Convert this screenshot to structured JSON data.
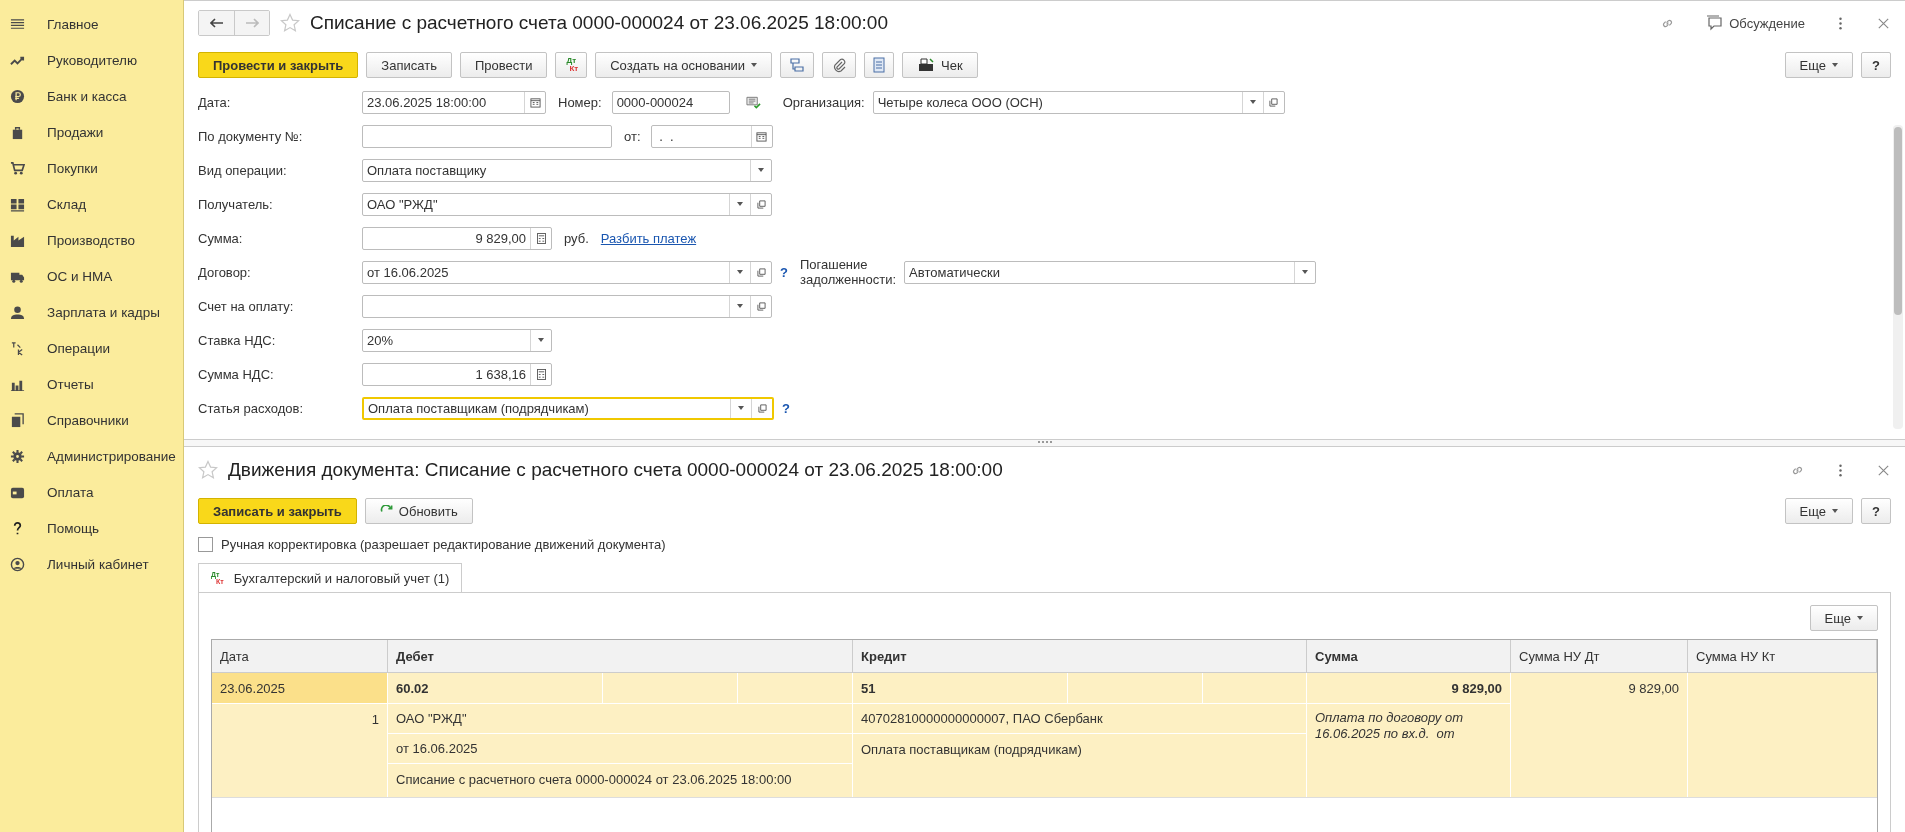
{
  "sidebar": {
    "items": [
      {
        "label": "Главное"
      },
      {
        "label": "Руководителю"
      },
      {
        "label": "Банк и касса"
      },
      {
        "label": "Продажи"
      },
      {
        "label": "Покупки"
      },
      {
        "label": "Склад"
      },
      {
        "label": "Производство"
      },
      {
        "label": "ОС и НМА"
      },
      {
        "label": "Зарплата и кадры"
      },
      {
        "label": "Операции"
      },
      {
        "label": "Отчеты"
      },
      {
        "label": "Справочники"
      },
      {
        "label": "Администрирование"
      },
      {
        "label": "Оплата"
      },
      {
        "label": "Помощь"
      },
      {
        "label": "Личный кабинет"
      }
    ]
  },
  "document": {
    "title": "Списание с расчетного счета 0000-000024 от 23.06.2025 18:00:00",
    "favorite": false,
    "discussion": "Обсуждение",
    "toolbar": {
      "post_close": "Провести и закрыть",
      "save": "Записать",
      "post": "Провести",
      "dt_icon": "Дт",
      "kt_icon": "Кт",
      "create_based": "Создать на основании",
      "check": "Чек",
      "more": "Еще",
      "help": "?"
    },
    "fields": {
      "date": {
        "label": "Дата:",
        "value": "23.06.2025 18:00:00"
      },
      "number": {
        "label": "Номер:",
        "value": "0000-000024"
      },
      "organization": {
        "label": "Организация:",
        "value": "Четыре колеса ООО (ОСН)"
      },
      "doc_number": {
        "label": "По документу №:"
      },
      "doc_date": {
        "label": "от:",
        "value": " .  ."
      },
      "operation": {
        "label": "Вид операции:",
        "value": "Оплата поставщику"
      },
      "recipient": {
        "label": "Получатель:",
        "value": "ОАО \"РЖД\""
      },
      "amount": {
        "label": "Сумма:",
        "value": "9 829,00",
        "currency": "руб.",
        "link": "Разбить платеж"
      },
      "contract": {
        "label": "Договор:",
        "value": "от 16.06.2025",
        "hint": "?"
      },
      "repayment": {
        "label_line1": "Погашение",
        "label_line2": "задолженности:",
        "value": "Автоматически"
      },
      "invoice": {
        "label": "Счет на оплату:"
      },
      "vat_rate": {
        "label": "Ставка НДС:",
        "value": "20%"
      },
      "vat_amount": {
        "label": "Сумма НДС:",
        "value": "1 638,16"
      },
      "expense": {
        "label": "Статья расходов:",
        "value": "Оплата поставщикам (подрядчикам)",
        "focused": true,
        "hint": "?"
      }
    }
  },
  "movements": {
    "title": "Движения документа: Списание с расчетного счета 0000-000024 от 23.06.2025 18:00:00",
    "favorite": false,
    "save_close": "Записать и закрыть",
    "refresh": "Обновить",
    "more": "Еще",
    "help": "?",
    "manual": {
      "label": "Ручная корректировка (разрешает редактирование движений документа)",
      "checked": false
    },
    "tabs": [
      {
        "label": "Бухгалтерский и налоговый учет (1)",
        "selected": true,
        "dt_icon": "Дт",
        "kt_icon": "Кт"
      }
    ],
    "table_more": "Еще",
    "table": {
      "columns": [
        {
          "label": "Дата",
          "bold": false
        },
        {
          "label": "Дебет",
          "bold": true
        },
        {
          "label": "Кредит",
          "bold": true
        },
        {
          "label": "Сумма",
          "bold": true
        },
        {
          "label": "Сумма НУ Дт",
          "bold": false
        },
        {
          "label": "Сумма НУ Кт",
          "bold": false
        }
      ],
      "rows": [
        {
          "selected": true,
          "date": "23.06.2025",
          "number": "1",
          "debit_account": "60.02",
          "debit_lines": [
            "ОАО \"РЖД\"",
            "от 16.06.2025",
            "Списание с расчетного счета 0000-000024 от 23.06.2025 18:00:00"
          ],
          "credit_account": "51",
          "credit_lines": [
            "40702810000000000007, ПАО Сбербанк",
            "Оплата поставщикам (подрядчикам)"
          ],
          "amount": "9 829,00",
          "content": "Оплата по договору от 16.06.2025 по вх.д.  от",
          "amount_nu_dt": "9 829,00"
        }
      ]
    }
  }
}
